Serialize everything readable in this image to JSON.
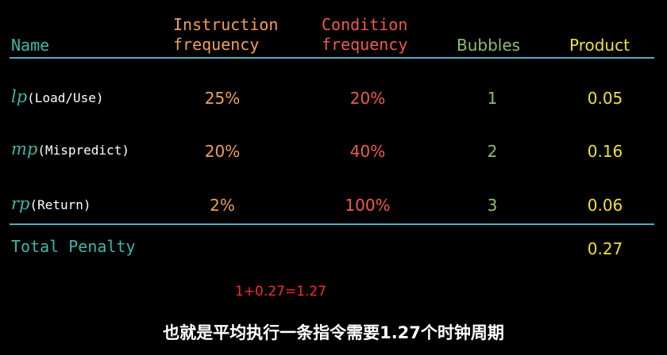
{
  "headers": {
    "name": "Name",
    "instruction_freq": [
      "Instruction",
      "frequency"
    ],
    "condition_freq": [
      "Condition",
      "frequency"
    ],
    "bubbles": "Bubbles",
    "product": "Product"
  },
  "rows": [
    {
      "symbol": "lp",
      "label": "(Load/Use)",
      "instruction_freq": "25%",
      "condition_freq": "20%",
      "bubbles": "1",
      "product": "0.05"
    },
    {
      "symbol": "mp",
      "label": "(Mispredict)",
      "instruction_freq": "20%",
      "condition_freq": "40%",
      "bubbles": "2",
      "product": "0.16"
    },
    {
      "symbol": "rp",
      "label": "(Return)",
      "instruction_freq": "2%",
      "condition_freq": "100%",
      "bubbles": "3",
      "product": "0.06"
    }
  ],
  "total": {
    "label": "Total Penalty",
    "value": "0.27"
  },
  "annotation": "1+0.27=1.27",
  "caption": "也就是平均执行一条指令需要1.27个时钟周期",
  "colors": {
    "background": "#000000",
    "name_teal": "#3fb6a8",
    "instruction_orange": "#f0a05a",
    "condition_red": "#ee5a4f",
    "bubbles_green": "#8fbf6a",
    "product_yellow": "#ece13a",
    "rule_blue": "#5aa9c8"
  }
}
